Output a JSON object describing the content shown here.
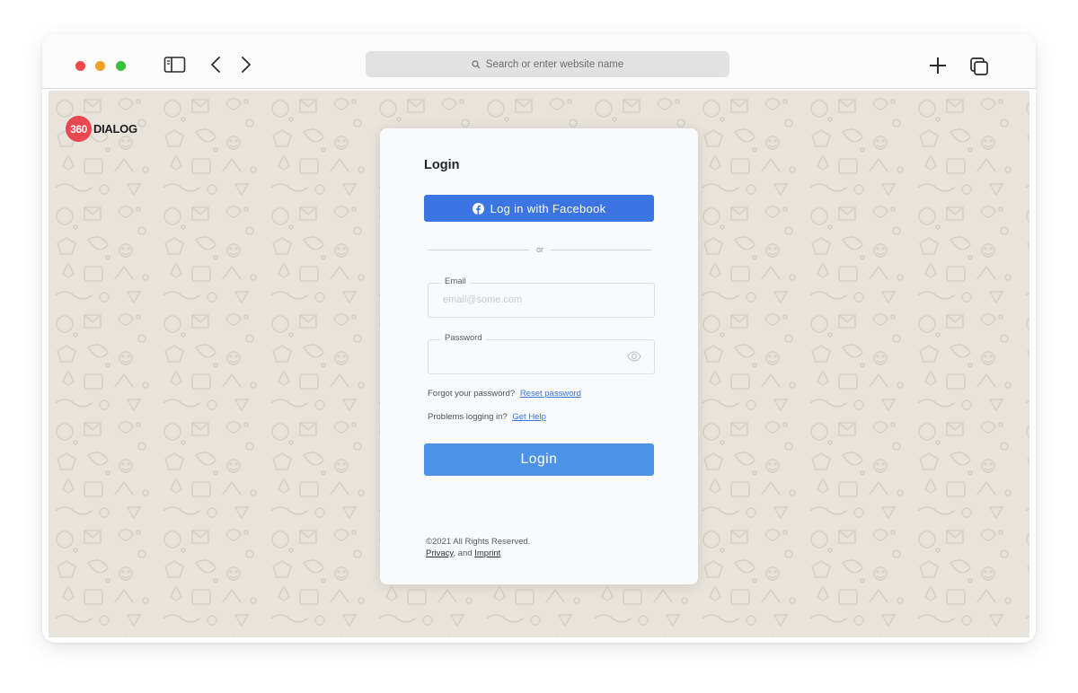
{
  "browser": {
    "address_placeholder": "Search or enter website name"
  },
  "brand": {
    "badge": "360",
    "name": "DIALOG",
    "color": "#e94850"
  },
  "login": {
    "title": "Login",
    "facebook_button": "Log in with Facebook",
    "divider": "or",
    "email_label": "Email",
    "email_placeholder": "email@some.com",
    "email_value": "",
    "password_label": "Password",
    "password_value": "",
    "forgot_text": "Forgot your password?",
    "reset_link": "Reset password",
    "problems_text": "Problems logging in?",
    "help_link": "Get Help",
    "submit_button": "Login"
  },
  "footer": {
    "copyright": "©2021 All Rights Reserved.",
    "privacy_link": "Privacy",
    "and_text": ", and",
    "imprint_link": "Imprint"
  },
  "colors": {
    "facebook_blue": "#3b74e3",
    "login_blue": "#4a93e6",
    "wallpaper": "#e8e4dc"
  },
  "icons": {
    "toolbar": [
      "sidebar-icon",
      "chevron-left-icon",
      "chevron-right-icon",
      "search-icon",
      "plus-icon",
      "tabs-icon"
    ],
    "facebook": "facebook-icon",
    "password_toggle": "eye-icon"
  }
}
